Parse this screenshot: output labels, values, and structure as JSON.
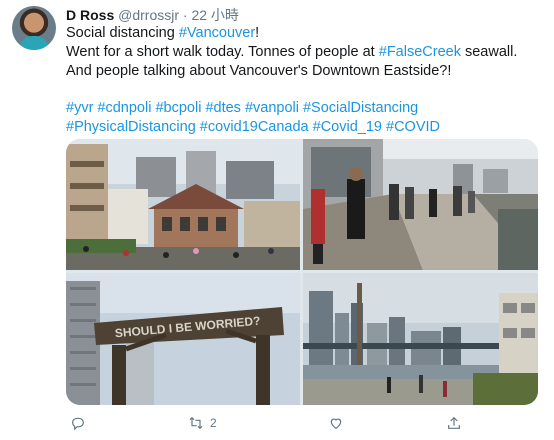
{
  "tweet": {
    "author_name": "D Ross",
    "author_handle": "@drrossjr",
    "separator": "·",
    "time": "22 小時",
    "line1_prefix": "Social distancing ",
    "line1_link": "#Vancouver",
    "line1_suffix": "!",
    "line2_prefix": "Went for a short walk today. Tonnes of people at ",
    "line2_link": "#FalseCreek",
    "line2_suffix": " seawall.",
    "line3": "And people talking about Vancouver's Downtown Eastside?!",
    "hashtags_line1": "#yvr #cdnpoli #bcpoli #dtes #vanpoli #SocialDistancing",
    "hashtags_line2": "#PhysicalDistancing #covid19Canada #Covid_19 #COVID"
  },
  "media": {
    "sign_text": "SHOULD I BE WORRIED?"
  },
  "actions": {
    "retweet_count": "2"
  },
  "icons": {
    "reply": "reply-icon",
    "retweet": "retweet-icon",
    "like": "heart-icon",
    "share": "share-icon"
  },
  "colors": {
    "link": "#1b95e0",
    "muted": "#657786",
    "text": "#14171a"
  }
}
